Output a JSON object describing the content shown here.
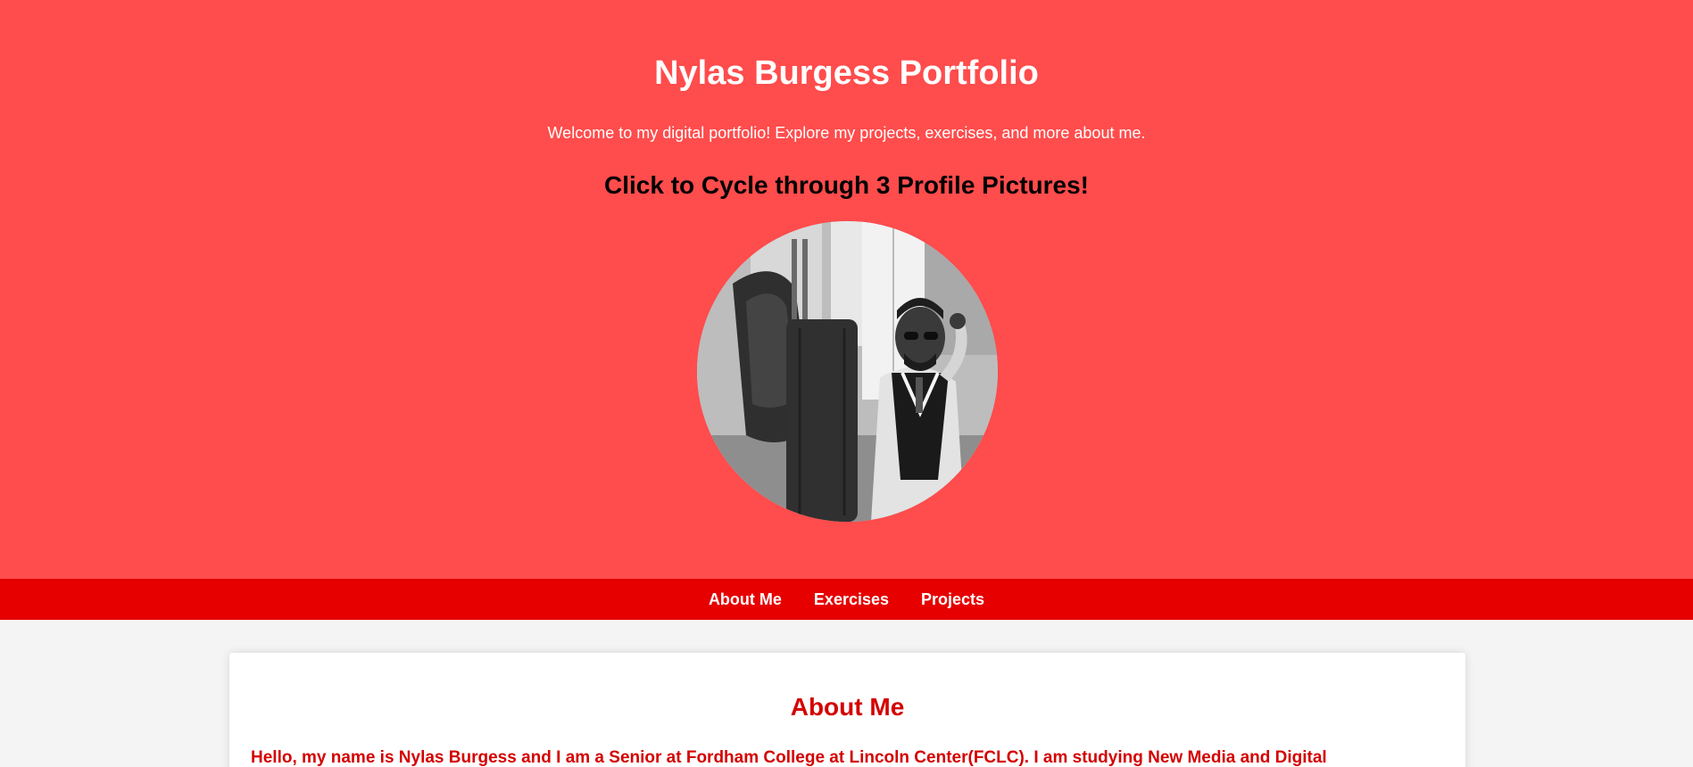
{
  "header": {
    "title": "Nylas Burgess Portfolio",
    "subtitle": "Welcome to my digital portfolio! Explore my projects, exercises, and more about me.",
    "cta": "Click to Cycle through 3 Profile Pictures!",
    "profile_image_icon": "profile-photo"
  },
  "nav": {
    "items": [
      {
        "label": "About Me"
      },
      {
        "label": "Exercises"
      },
      {
        "label": "Projects"
      }
    ]
  },
  "about": {
    "title": "About Me",
    "text": "Hello, my name is Nylas Burgess and I am a Senior at Fordham College at Lincoln Center(FCLC). I am studying New Media and Digital"
  },
  "colors": {
    "hero_bg": "#ff4c4c",
    "nav_bg": "#e60000",
    "accent_text": "#d40000",
    "page_bg": "#f4f4f4"
  }
}
